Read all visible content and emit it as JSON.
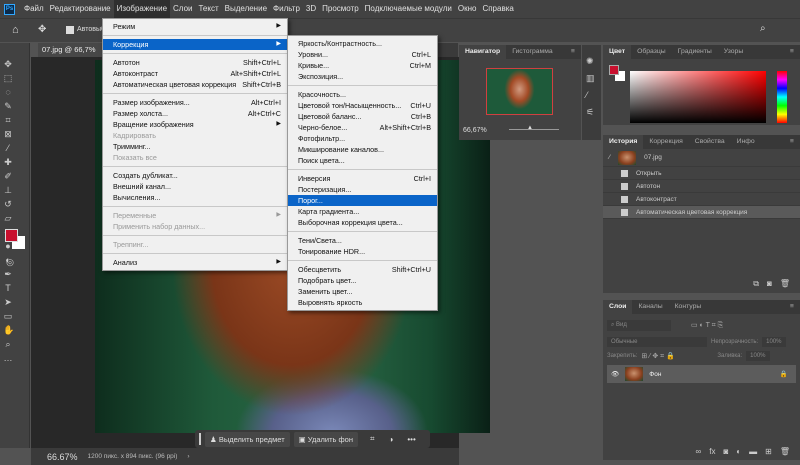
{
  "menubar": {
    "items": [
      "Файл",
      "Редактирование",
      "Изображение",
      "Слои",
      "Текст",
      "Выделение",
      "Фильтр",
      "3D",
      "Просмотр",
      "Подключаемые модули",
      "Окно",
      "Справка"
    ],
    "active": "Изображение"
  },
  "options": {
    "autoselect": "Автовыбо"
  },
  "document": {
    "tab": "07.jpg @ 66,7%"
  },
  "image_menu": [
    {
      "label": "Режим",
      "sub": true
    },
    {
      "sep": true
    },
    {
      "label": "Коррекция",
      "sub": true,
      "hl": true
    },
    {
      "sep": true
    },
    {
      "label": "Автотон",
      "sc": "Shift+Ctrl+L"
    },
    {
      "label": "Автоконтраст",
      "sc": "Alt+Shift+Ctrl+L"
    },
    {
      "label": "Автоматическая цветовая коррекция",
      "sc": "Shift+Ctrl+B"
    },
    {
      "sep": true
    },
    {
      "label": "Размер изображения...",
      "sc": "Alt+Ctrl+I"
    },
    {
      "label": "Размер холста...",
      "sc": "Alt+Ctrl+C"
    },
    {
      "label": "Вращение изображения",
      "sub": true
    },
    {
      "label": "Кадрировать",
      "dis": true
    },
    {
      "label": "Тримминг..."
    },
    {
      "label": "Показать все",
      "dis": true
    },
    {
      "sep": true
    },
    {
      "label": "Создать дубликат..."
    },
    {
      "label": "Внешний канал..."
    },
    {
      "label": "Вычисления..."
    },
    {
      "sep": true
    },
    {
      "label": "Переменные",
      "sub": true,
      "dis": true
    },
    {
      "label": "Применить набор данных...",
      "dis": true
    },
    {
      "sep": true
    },
    {
      "label": "Треппинг...",
      "dis": true
    },
    {
      "sep": true
    },
    {
      "label": "Анализ",
      "sub": true
    }
  ],
  "correction_menu": [
    {
      "label": "Яркость/Контрастность..."
    },
    {
      "label": "Уровни...",
      "sc": "Ctrl+L"
    },
    {
      "label": "Кривые...",
      "sc": "Ctrl+M"
    },
    {
      "label": "Экспозиция..."
    },
    {
      "sep": true
    },
    {
      "label": "Красочность..."
    },
    {
      "label": "Цветовой тон/Насыщенность...",
      "sc": "Ctrl+U"
    },
    {
      "label": "Цветовой баланс...",
      "sc": "Ctrl+B"
    },
    {
      "label": "Черно-белое...",
      "sc": "Alt+Shift+Ctrl+B"
    },
    {
      "label": "Фотофильтр..."
    },
    {
      "label": "Микширование каналов..."
    },
    {
      "label": "Поиск цвета..."
    },
    {
      "sep": true
    },
    {
      "label": "Инверсия",
      "sc": "Ctrl+I"
    },
    {
      "label": "Постеризация..."
    },
    {
      "label": "Порог...",
      "hl": true
    },
    {
      "label": "Карта градиента..."
    },
    {
      "label": "Выборочная коррекция цвета..."
    },
    {
      "sep": true
    },
    {
      "label": "Тени/Света..."
    },
    {
      "label": "Тонирование HDR..."
    },
    {
      "sep": true
    },
    {
      "label": "Обесцветить",
      "sc": "Shift+Ctrl+U"
    },
    {
      "label": "Подобрать цвет..."
    },
    {
      "label": "Заменить цвет..."
    },
    {
      "label": "Выровнять яркость"
    }
  ],
  "navigator": {
    "tabs": [
      "Навигатор",
      "Гистограмма"
    ],
    "zoom": "66,67%"
  },
  "color": {
    "tabs": [
      "Цвет",
      "Образцы",
      "Градиенты",
      "Узоры"
    ],
    "fg": "#c8102e",
    "bg": "#ffffff"
  },
  "history": {
    "tabs": [
      "История",
      "Коррекция",
      "Свойства",
      "Инфо"
    ],
    "snapshot": "07.jpg",
    "items": [
      "Открыть",
      "Автотон",
      "Автоконтраст",
      "Автоматическая цветовая коррекция"
    ]
  },
  "layers": {
    "tabs": [
      "Слои",
      "Каналы",
      "Контуры"
    ],
    "search": "Вид",
    "blend": "Обычные",
    "opacity_label": "Непрозрачность:",
    "opacity": "100%",
    "lock_label": "Закрепить:",
    "fill_label": "Заливка:",
    "fill": "100%",
    "layer": "Фон"
  },
  "context_bar": {
    "select_subject": "Выделить предмет",
    "remove_bg": "Удалить фон"
  },
  "status": {
    "zoom": "66.67%",
    "info": "1200 пикс. x 894 пикс. (96 ppi)"
  }
}
